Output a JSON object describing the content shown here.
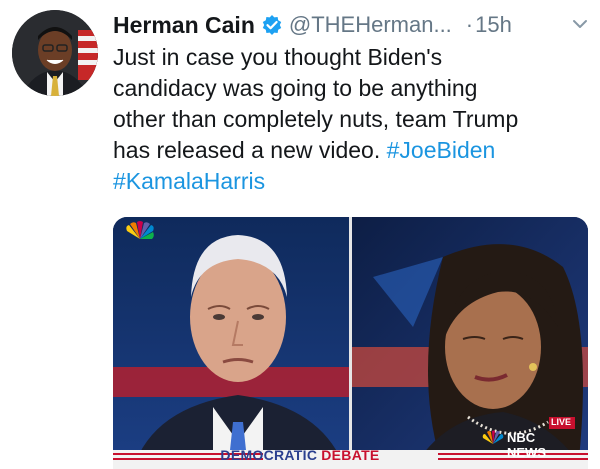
{
  "author": {
    "name": "Herman Cain",
    "handle": "@THEHerman...",
    "dot": "·",
    "time": "15h",
    "verified": true,
    "avatar_icon": "profile-photo"
  },
  "tweet": {
    "line1": "Just in case you thought Biden's",
    "line2": "candidacy was going to be anything",
    "line3": "other than completely nuts, team Trump",
    "line4_text": "has released a new video. ",
    "hashtag1": "#JoeBiden",
    "hashtag2": "#KamalaHarris"
  },
  "media": {
    "live_label": "LIVE",
    "network_label": "NBC NEWS",
    "banner_left": "DEMOCRATIC",
    "banner_right": "DEBATE"
  },
  "colors": {
    "link": "#1b95e0",
    "secondary": "#657786",
    "verified": "#1da1f2",
    "banner_blue": "#2b3f8f",
    "banner_red": "#c8102e"
  }
}
